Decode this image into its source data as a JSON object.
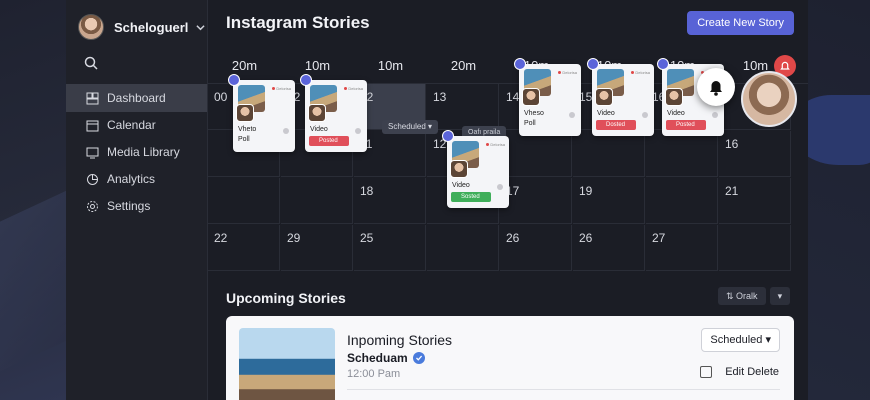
{
  "account": {
    "name": "Scheloguerl"
  },
  "sidebar": {
    "items": [
      {
        "label": "Dashboard",
        "icon": "dashboard-icon",
        "active": true
      },
      {
        "label": "Calendar",
        "icon": "calendar-icon"
      },
      {
        "label": "Media Library",
        "icon": "media-library-icon"
      },
      {
        "label": "Analytics",
        "icon": "analytics-icon"
      },
      {
        "label": "Settings",
        "icon": "settings-icon"
      }
    ]
  },
  "header": {
    "title": "Instagram Stories",
    "create_label": "Create New Story"
  },
  "calendar": {
    "columns": [
      "20m",
      "10m",
      "10m",
      "20m",
      "10m",
      "10m",
      "10m",
      "10m"
    ],
    "rows": [
      [
        "00",
        "12",
        "12",
        "13",
        "14",
        "15",
        "16",
        ""
      ],
      [
        "",
        "",
        "11",
        "12",
        "",
        "",
        "",
        "16"
      ],
      [
        "",
        "",
        "18",
        "",
        "17",
        "19",
        "",
        "21"
      ],
      [
        "22",
        "29",
        "25",
        "",
        "26",
        "26",
        "27",
        ""
      ]
    ],
    "scheduled_pill": "Scheduled",
    "draft_pill": "Oafı praila"
  },
  "cards": [
    {
      "title": "Vheto",
      "sub": "Poll",
      "status": "",
      "tag": "Delorisa"
    },
    {
      "title": "Video",
      "sub": "",
      "status": "Posted",
      "tag": "Delorisa"
    },
    {
      "title": "Video",
      "sub": "",
      "status": "Sosted",
      "tag": "Delorisa"
    },
    {
      "title": "Vheso",
      "sub": "Poll",
      "status": "",
      "tag": "Delorisa"
    },
    {
      "title": "Video",
      "sub": "",
      "status": "Dosted",
      "tag": "Delorisa"
    },
    {
      "title": "Video",
      "sub": "",
      "status": "Posted",
      "tag": "Delorisa"
    }
  ],
  "upcoming": {
    "title": "Upcoming Stories",
    "tool_label": "Oralk",
    "card": {
      "title": "Inpoming Stories",
      "subtitle": "Scheduam",
      "time": "12:00 Pam",
      "select_value": "Scheduled",
      "actions": "Edit Delete"
    }
  },
  "colors": {
    "accent": "#5863d6",
    "posted": "#e04f5a",
    "green": "#3fae5a",
    "badge": "#e04848"
  }
}
